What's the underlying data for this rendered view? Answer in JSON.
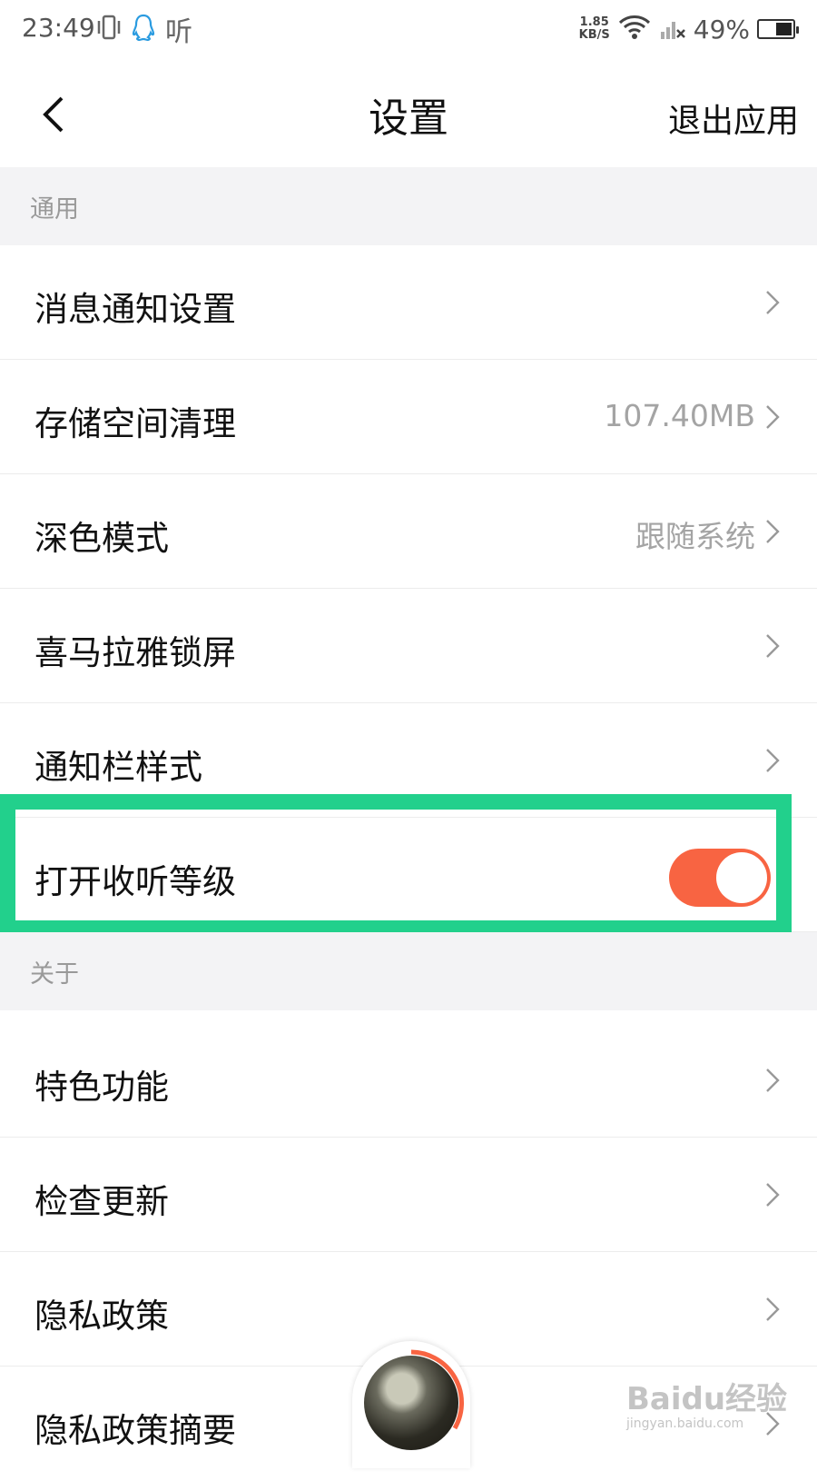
{
  "status_bar": {
    "time": "23:49",
    "app_glyph": "听",
    "speed_value": "1.85",
    "speed_unit": "KB/S",
    "battery_percent": "49%",
    "battery_level": 0.49,
    "icons": [
      "vibrate-icon",
      "qq-icon",
      "wifi-icon",
      "signal-off-icon",
      "battery-icon"
    ]
  },
  "header": {
    "title": "设置",
    "exit_label": "退出应用"
  },
  "sections": {
    "general": {
      "title": "通用",
      "items": [
        {
          "label": "消息通知设置",
          "value": ""
        },
        {
          "label": "存储空间清理",
          "value": "107.40MB"
        },
        {
          "label": "深色模式",
          "value": "跟随系统"
        },
        {
          "label": "喜马拉雅锁屏",
          "value": ""
        },
        {
          "label": "通知栏样式",
          "value": ""
        },
        {
          "label": "打开收听等级",
          "value": "",
          "toggle_on": true
        }
      ]
    },
    "about": {
      "title": "关于",
      "items": [
        {
          "label": "特色功能"
        },
        {
          "label": "检查更新"
        },
        {
          "label": "隐私政策"
        },
        {
          "label": "隐私政策摘要"
        }
      ]
    }
  },
  "watermark": {
    "main": "Baidu经验",
    "sub": "jingyan.baidu.com"
  },
  "colors": {
    "accent": "#f86442",
    "highlight": "#22d08c",
    "section_bg": "#f3f3f5",
    "secondary_text": "#a4a4a4"
  }
}
